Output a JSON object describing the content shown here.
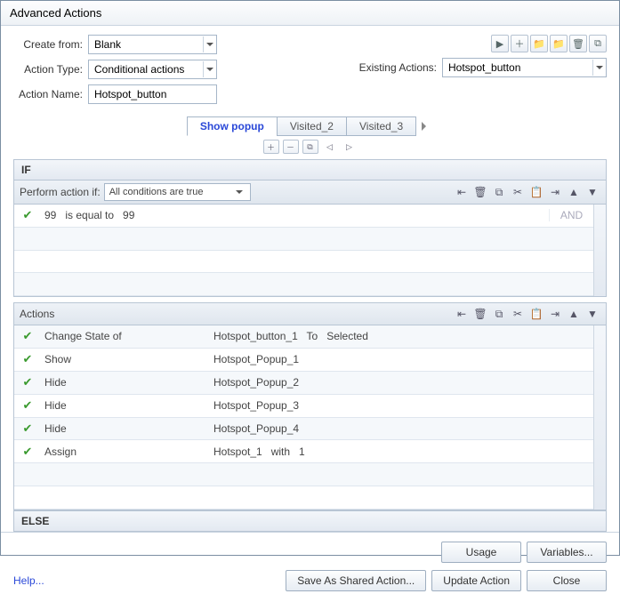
{
  "title": "Advanced Actions",
  "form": {
    "create_from_label": "Create from:",
    "create_from_value": "Blank",
    "action_type_label": "Action Type:",
    "action_type_value": "Conditional actions",
    "action_name_label": "Action Name:",
    "action_name_value": "Hotspot_button",
    "existing_actions_label": "Existing Actions:",
    "existing_actions_value": "Hotspot_button"
  },
  "tabs": [
    {
      "label": "Show popup",
      "active": true
    },
    {
      "label": "Visited_2",
      "active": false
    },
    {
      "label": "Visited_3",
      "active": false
    }
  ],
  "if_section": {
    "header": "IF",
    "perform_label": "Perform action if:",
    "perform_value": "All conditions are true",
    "rows": [
      {
        "c1": "99   is equal to   99",
        "c2": "",
        "c3": "AND"
      }
    ]
  },
  "actions_section": {
    "header": "Actions",
    "rows": [
      {
        "c1": "Change State of",
        "c2": "Hotspot_button_1   To   Selected"
      },
      {
        "c1": "Show",
        "c2": "Hotspot_Popup_1"
      },
      {
        "c1": "Hide",
        "c2": "Hotspot_Popup_2"
      },
      {
        "c1": "Hide",
        "c2": "Hotspot_Popup_3"
      },
      {
        "c1": "Hide",
        "c2": "Hotspot_Popup_4"
      },
      {
        "c1": "Assign",
        "c2": "Hotspot_1   with   1"
      }
    ]
  },
  "else_header": "ELSE",
  "buttons": {
    "usage": "Usage",
    "variables": "Variables...",
    "save_shared": "Save As Shared Action...",
    "update": "Update Action",
    "close": "Close",
    "help": "Help..."
  },
  "top_icons": [
    "▶",
    "＋",
    "📁",
    "📁",
    "🗑",
    "⧉"
  ],
  "row_icons": [
    "⇤",
    "🗑",
    "⧉",
    "✂",
    "📋",
    "⇥",
    "▲",
    "▼"
  ],
  "tab_icons": [
    "＋",
    "－",
    "⧉",
    "◁",
    "▷"
  ]
}
